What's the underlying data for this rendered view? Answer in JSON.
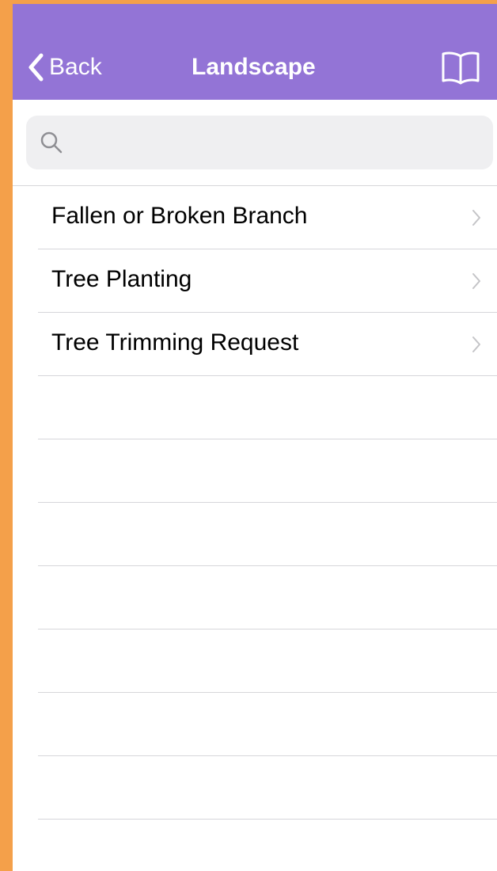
{
  "nav": {
    "back_label": "Back",
    "title": "Landscape",
    "bar_color": "#9374D6",
    "book_icon": "book-icon"
  },
  "search": {
    "placeholder": "",
    "value": ""
  },
  "list": {
    "items": [
      {
        "label": "Fallen or Broken Branch"
      },
      {
        "label": "Tree Planting"
      },
      {
        "label": "Tree Trimming Request"
      }
    ]
  },
  "frame": {
    "accent_color": "#F4A04A"
  }
}
